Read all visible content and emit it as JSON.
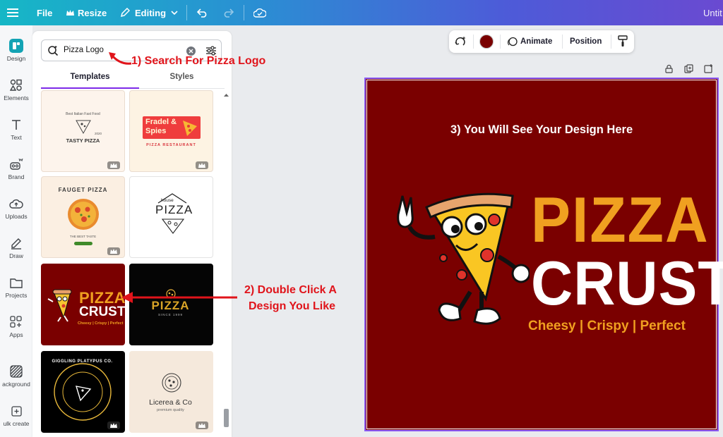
{
  "topbar": {
    "file": "File",
    "resize": "Resize",
    "editing": "Editing",
    "doc_title": "Untit"
  },
  "rail": [
    {
      "label": "Design",
      "icon": "design-icon"
    },
    {
      "label": "Elements",
      "icon": "elements-icon"
    },
    {
      "label": "Text",
      "icon": "text-icon"
    },
    {
      "label": "Brand",
      "icon": "brand-icon"
    },
    {
      "label": "Uploads",
      "icon": "uploads-icon"
    },
    {
      "label": "Draw",
      "icon": "draw-icon"
    },
    {
      "label": "Projects",
      "icon": "projects-icon"
    },
    {
      "label": "Apps",
      "icon": "apps-icon"
    },
    {
      "label": "ackground",
      "icon": "background-icon"
    },
    {
      "label": "ulk create",
      "icon": "bulk-create-icon"
    }
  ],
  "search": {
    "query": "Pizza Logo"
  },
  "tabs": {
    "templates": "Templates",
    "styles": "Styles"
  },
  "templates": {
    "t1": {
      "top": "Best Italian Fast Food",
      "year": "2020",
      "name": "TASTY PIZZA"
    },
    "t2": {
      "l1": "Fradel &",
      "l2": "Spies",
      "sub": "PIZZA RESTAURANT"
    },
    "t3": {
      "arc": "FAUGET PIZZA",
      "sub": "THE BEST TASTE"
    },
    "t4": {
      "small": "house",
      "big": "PIZZA"
    },
    "t5": {
      "l1": "PIZZA",
      "l2": "CRUST",
      "tag": "Cheesy | Crispy | Perfect"
    },
    "t6": {
      "name": "PIZZA",
      "sub": "SINCE 1999"
    },
    "t7": {
      "ring": "GIGGLING PLATYPUS CO."
    },
    "t8": {
      "name": "Licerea & Co",
      "sub": "premium quality"
    }
  },
  "canvas_tools": {
    "animate": "Animate",
    "position": "Position",
    "color": "#7a0000"
  },
  "design": {
    "line1": "PIZZA",
    "line2": "CRUST",
    "tagline": "Cheesy | Crispy | Perfect"
  },
  "annotations": {
    "a1": "1) Search For Pizza Logo",
    "a2a": "2) Double Click A",
    "a2b": "Design You Like",
    "a3": "3) You Will See Your Design Here"
  },
  "colors": {
    "brand_gradient_start": "#16b7c6",
    "brand_gradient_end": "#6a4ad1",
    "design_bg": "#7a0000",
    "pizza_orange": "#f0a020",
    "annotation_red": "#e0141b",
    "selection": "#8b5cf6"
  }
}
